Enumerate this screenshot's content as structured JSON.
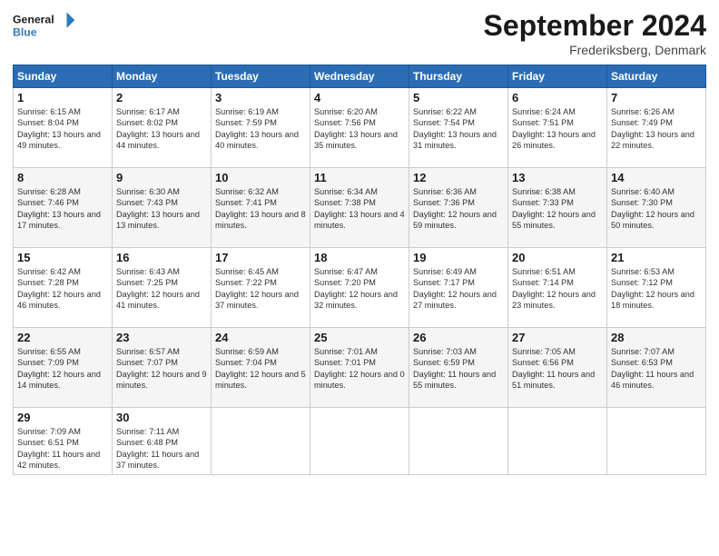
{
  "header": {
    "logo_line1": "General",
    "logo_line2": "Blue",
    "month_title": "September 2024",
    "location": "Frederiksberg, Denmark"
  },
  "weekdays": [
    "Sunday",
    "Monday",
    "Tuesday",
    "Wednesday",
    "Thursday",
    "Friday",
    "Saturday"
  ],
  "weeks": [
    [
      {
        "day": "1",
        "sunrise": "6:15 AM",
        "sunset": "8:04 PM",
        "daylight": "13 hours and 49 minutes."
      },
      {
        "day": "2",
        "sunrise": "6:17 AM",
        "sunset": "8:02 PM",
        "daylight": "13 hours and 44 minutes."
      },
      {
        "day": "3",
        "sunrise": "6:19 AM",
        "sunset": "7:59 PM",
        "daylight": "13 hours and 40 minutes."
      },
      {
        "day": "4",
        "sunrise": "6:20 AM",
        "sunset": "7:56 PM",
        "daylight": "13 hours and 35 minutes."
      },
      {
        "day": "5",
        "sunrise": "6:22 AM",
        "sunset": "7:54 PM",
        "daylight": "13 hours and 31 minutes."
      },
      {
        "day": "6",
        "sunrise": "6:24 AM",
        "sunset": "7:51 PM",
        "daylight": "13 hours and 26 minutes."
      },
      {
        "day": "7",
        "sunrise": "6:26 AM",
        "sunset": "7:49 PM",
        "daylight": "13 hours and 22 minutes."
      }
    ],
    [
      {
        "day": "8",
        "sunrise": "6:28 AM",
        "sunset": "7:46 PM",
        "daylight": "13 hours and 17 minutes."
      },
      {
        "day": "9",
        "sunrise": "6:30 AM",
        "sunset": "7:43 PM",
        "daylight": "13 hours and 13 minutes."
      },
      {
        "day": "10",
        "sunrise": "6:32 AM",
        "sunset": "7:41 PM",
        "daylight": "13 hours and 8 minutes."
      },
      {
        "day": "11",
        "sunrise": "6:34 AM",
        "sunset": "7:38 PM",
        "daylight": "13 hours and 4 minutes."
      },
      {
        "day": "12",
        "sunrise": "6:36 AM",
        "sunset": "7:36 PM",
        "daylight": "12 hours and 59 minutes."
      },
      {
        "day": "13",
        "sunrise": "6:38 AM",
        "sunset": "7:33 PM",
        "daylight": "12 hours and 55 minutes."
      },
      {
        "day": "14",
        "sunrise": "6:40 AM",
        "sunset": "7:30 PM",
        "daylight": "12 hours and 50 minutes."
      }
    ],
    [
      {
        "day": "15",
        "sunrise": "6:42 AM",
        "sunset": "7:28 PM",
        "daylight": "12 hours and 46 minutes."
      },
      {
        "day": "16",
        "sunrise": "6:43 AM",
        "sunset": "7:25 PM",
        "daylight": "12 hours and 41 minutes."
      },
      {
        "day": "17",
        "sunrise": "6:45 AM",
        "sunset": "7:22 PM",
        "daylight": "12 hours and 37 minutes."
      },
      {
        "day": "18",
        "sunrise": "6:47 AM",
        "sunset": "7:20 PM",
        "daylight": "12 hours and 32 minutes."
      },
      {
        "day": "19",
        "sunrise": "6:49 AM",
        "sunset": "7:17 PM",
        "daylight": "12 hours and 27 minutes."
      },
      {
        "day": "20",
        "sunrise": "6:51 AM",
        "sunset": "7:14 PM",
        "daylight": "12 hours and 23 minutes."
      },
      {
        "day": "21",
        "sunrise": "6:53 AM",
        "sunset": "7:12 PM",
        "daylight": "12 hours and 18 minutes."
      }
    ],
    [
      {
        "day": "22",
        "sunrise": "6:55 AM",
        "sunset": "7:09 PM",
        "daylight": "12 hours and 14 minutes."
      },
      {
        "day": "23",
        "sunrise": "6:57 AM",
        "sunset": "7:07 PM",
        "daylight": "12 hours and 9 minutes."
      },
      {
        "day": "24",
        "sunrise": "6:59 AM",
        "sunset": "7:04 PM",
        "daylight": "12 hours and 5 minutes."
      },
      {
        "day": "25",
        "sunrise": "7:01 AM",
        "sunset": "7:01 PM",
        "daylight": "12 hours and 0 minutes."
      },
      {
        "day": "26",
        "sunrise": "7:03 AM",
        "sunset": "6:59 PM",
        "daylight": "11 hours and 55 minutes."
      },
      {
        "day": "27",
        "sunrise": "7:05 AM",
        "sunset": "6:56 PM",
        "daylight": "11 hours and 51 minutes."
      },
      {
        "day": "28",
        "sunrise": "7:07 AM",
        "sunset": "6:53 PM",
        "daylight": "11 hours and 46 minutes."
      }
    ],
    [
      {
        "day": "29",
        "sunrise": "7:09 AM",
        "sunset": "6:51 PM",
        "daylight": "11 hours and 42 minutes."
      },
      {
        "day": "30",
        "sunrise": "7:11 AM",
        "sunset": "6:48 PM",
        "daylight": "11 hours and 37 minutes."
      },
      null,
      null,
      null,
      null,
      null
    ]
  ]
}
